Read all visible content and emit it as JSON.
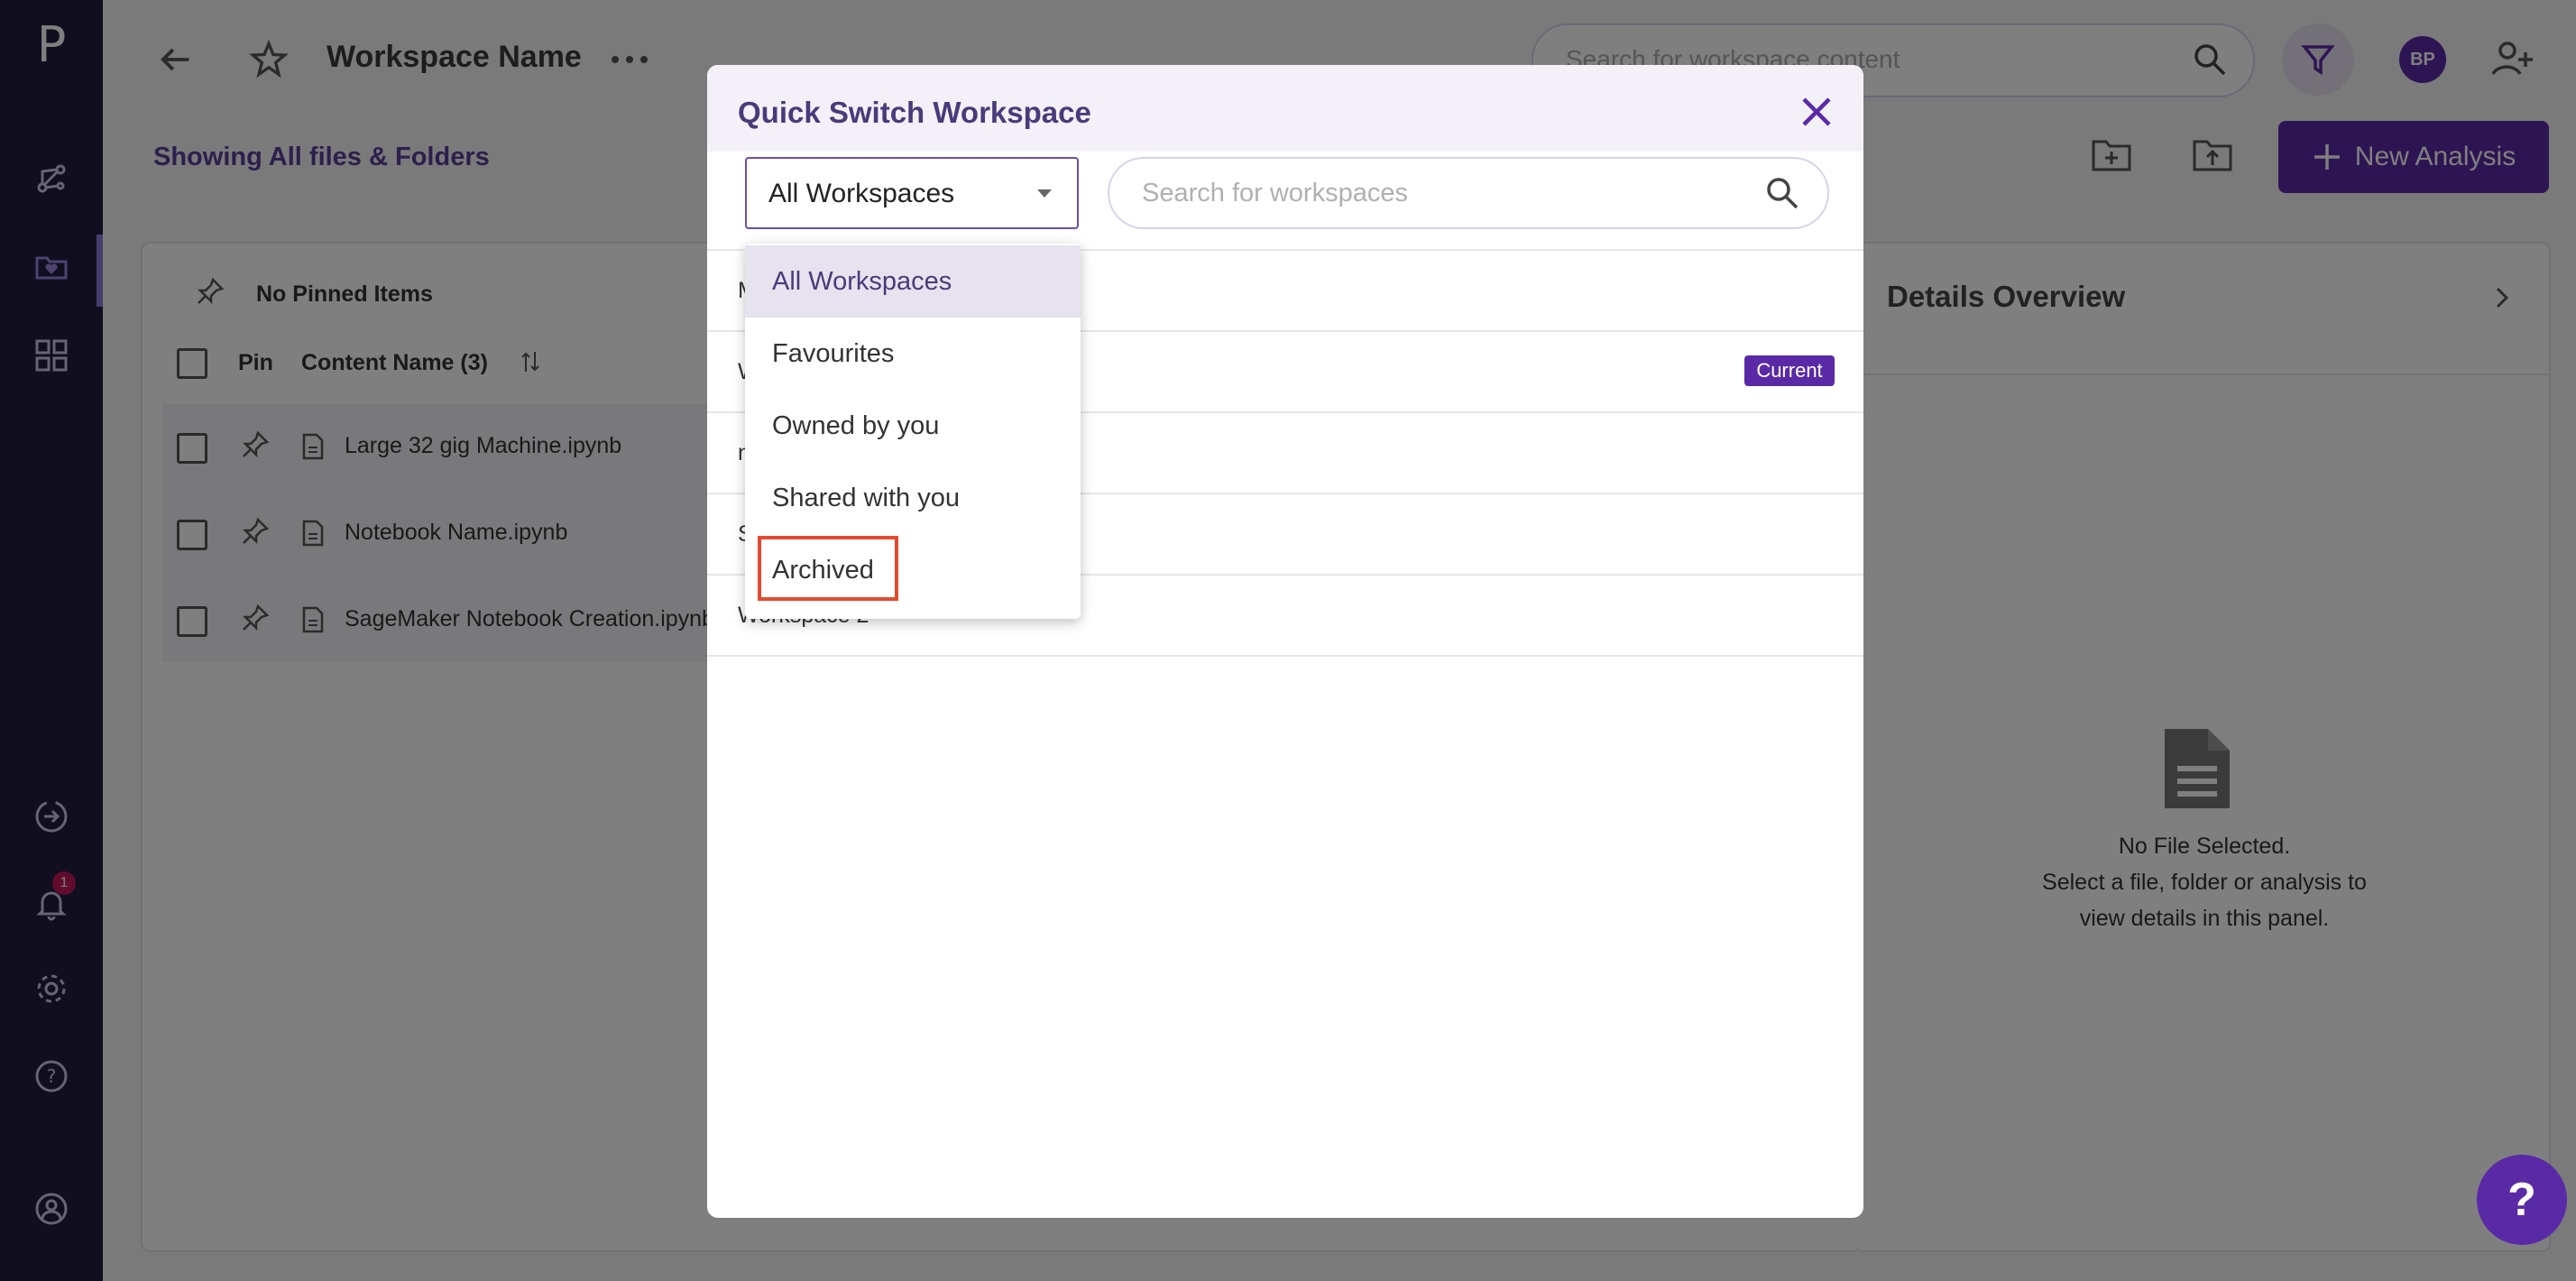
{
  "sidebar": {
    "logo": "P",
    "notification_count": "1"
  },
  "header": {
    "workspace_name": "Workspace Name",
    "search_placeholder": "Search for workspace content",
    "avatar_initials": "BP",
    "new_analysis_label": "New Analysis"
  },
  "content": {
    "showing_label": "Showing All files & Folders",
    "pinned_label": "No Pinned Items",
    "col_pin": "Pin",
    "col_content_name": "Content Name (3)",
    "files": [
      "Large 32 gig Machine.ipynb",
      "Notebook Name.ipynb",
      "SageMaker Notebook Creation.ipynb"
    ]
  },
  "details": {
    "title": "Details Overview",
    "empty_title": "No File Selected.",
    "empty_line1": "Select a file, folder or analysis to",
    "empty_line2": "view details in this panel."
  },
  "modal": {
    "title": "Quick Switch Workspace",
    "select_value": "All Workspaces",
    "search_placeholder": "Search for workspaces",
    "rows": [
      "M",
      "W",
      "n",
      "S",
      "Workspace 2"
    ],
    "current_badge": "Current",
    "dropdown_options": [
      "All Workspaces",
      "Favourites",
      "Owned by you",
      "Shared with you",
      "Archived"
    ]
  },
  "help_fab": "?"
}
